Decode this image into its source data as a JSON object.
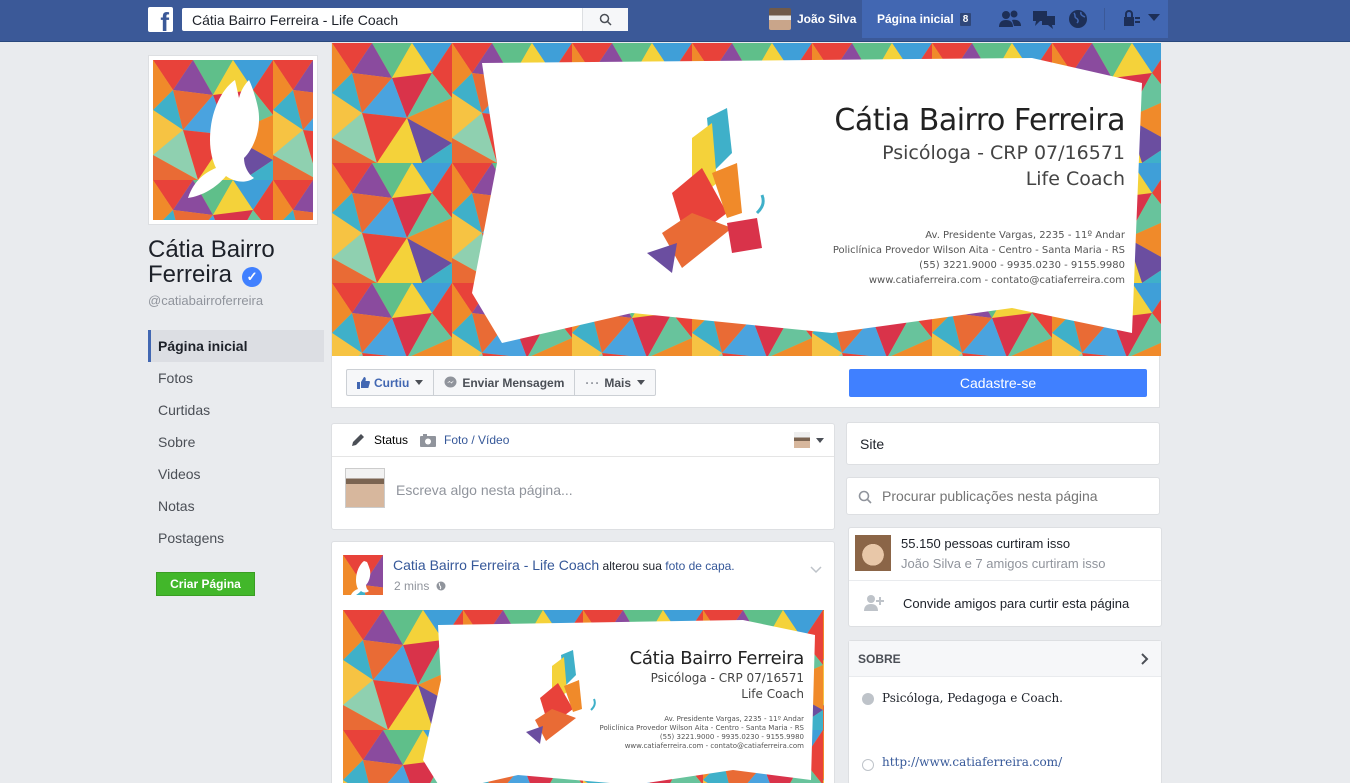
{
  "topbar": {
    "logo": "f",
    "search_value": "Cátia Bairro Ferreira - Life Coach",
    "user_name": "João Silva",
    "home_label": "Página inicial",
    "home_badge": "8",
    "icons": [
      "search-icon",
      "friend-requests-icon",
      "messages-icon",
      "notifications-globe-icon",
      "privacy-lock-icon",
      "account-caret-icon"
    ]
  },
  "page": {
    "name": "Cátia Bairro Ferreira",
    "verified_mark": "✓",
    "handle": "@catiabairroferreira"
  },
  "sidebar": {
    "items": [
      {
        "label": "Página inicial",
        "active": true
      },
      {
        "label": "Fotos"
      },
      {
        "label": "Curtidas"
      },
      {
        "label": "Sobre"
      },
      {
        "label": "Videos"
      },
      {
        "label": "Notas"
      },
      {
        "label": "Postagens"
      }
    ],
    "create_label": "Criar Página"
  },
  "cover": {
    "name": "Cátia Bairro Ferreira",
    "line1": "Psicóloga - CRP 07/16571",
    "line2": "Life Coach",
    "addr1": "Av. Presidente Vargas, 2235 - 11º Andar",
    "addr2": "Policlínica Provedor Wilson Aita - Centro - Santa Maria - RS",
    "addr3": "(55) 3221.9000 - 9935.0230 - 9155.9980",
    "addr4": "www.catiaferreira.com - contato@catiaferreira.com"
  },
  "actions": {
    "like": "Curtiu",
    "message": "Enviar Mensagem",
    "more": "Mais",
    "signup": "Cadastre-se"
  },
  "composer": {
    "tab_status": "Status",
    "tab_photo": "Foto / Vídeo",
    "placeholder": "Escreva algo nesta página..."
  },
  "post": {
    "author": "Catia Bairro Ferreira - Life Coach",
    "action": "alterou sua",
    "link": "foto de capa.",
    "time": "2 mins"
  },
  "right": {
    "site_label": "Site",
    "search_placeholder": "Procurar publicações nesta página",
    "likes_count": "55.150 pessoas curtiram isso",
    "likes_friends": "João Silva e 7 amigos curtiram isso",
    "invite": "Convide amigos para curtir esta página",
    "about_title": "SOBRE",
    "about_desc": "Psicóloga, Pedagoga e Coach.",
    "about_url": "http://www.catiaferreira.com/"
  },
  "colors": {
    "brand": "#3b5998",
    "signup": "#4080ff",
    "create": "#42b72a"
  }
}
